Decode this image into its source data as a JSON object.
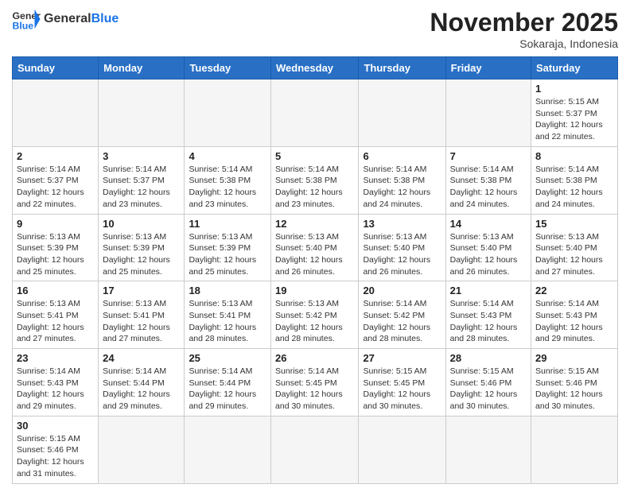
{
  "header": {
    "logo_general": "General",
    "logo_blue": "Blue",
    "month": "November 2025",
    "location": "Sokaraja, Indonesia"
  },
  "weekdays": [
    "Sunday",
    "Monday",
    "Tuesday",
    "Wednesday",
    "Thursday",
    "Friday",
    "Saturday"
  ],
  "weeks": [
    [
      {
        "day": "",
        "info": ""
      },
      {
        "day": "",
        "info": ""
      },
      {
        "day": "",
        "info": ""
      },
      {
        "day": "",
        "info": ""
      },
      {
        "day": "",
        "info": ""
      },
      {
        "day": "",
        "info": ""
      },
      {
        "day": "1",
        "info": "Sunrise: 5:15 AM\nSunset: 5:37 PM\nDaylight: 12 hours and 22 minutes."
      }
    ],
    [
      {
        "day": "2",
        "info": "Sunrise: 5:14 AM\nSunset: 5:37 PM\nDaylight: 12 hours and 22 minutes."
      },
      {
        "day": "3",
        "info": "Sunrise: 5:14 AM\nSunset: 5:37 PM\nDaylight: 12 hours and 23 minutes."
      },
      {
        "day": "4",
        "info": "Sunrise: 5:14 AM\nSunset: 5:38 PM\nDaylight: 12 hours and 23 minutes."
      },
      {
        "day": "5",
        "info": "Sunrise: 5:14 AM\nSunset: 5:38 PM\nDaylight: 12 hours and 23 minutes."
      },
      {
        "day": "6",
        "info": "Sunrise: 5:14 AM\nSunset: 5:38 PM\nDaylight: 12 hours and 24 minutes."
      },
      {
        "day": "7",
        "info": "Sunrise: 5:14 AM\nSunset: 5:38 PM\nDaylight: 12 hours and 24 minutes."
      },
      {
        "day": "8",
        "info": "Sunrise: 5:14 AM\nSunset: 5:38 PM\nDaylight: 12 hours and 24 minutes."
      }
    ],
    [
      {
        "day": "9",
        "info": "Sunrise: 5:13 AM\nSunset: 5:39 PM\nDaylight: 12 hours and 25 minutes."
      },
      {
        "day": "10",
        "info": "Sunrise: 5:13 AM\nSunset: 5:39 PM\nDaylight: 12 hours and 25 minutes."
      },
      {
        "day": "11",
        "info": "Sunrise: 5:13 AM\nSunset: 5:39 PM\nDaylight: 12 hours and 25 minutes."
      },
      {
        "day": "12",
        "info": "Sunrise: 5:13 AM\nSunset: 5:40 PM\nDaylight: 12 hours and 26 minutes."
      },
      {
        "day": "13",
        "info": "Sunrise: 5:13 AM\nSunset: 5:40 PM\nDaylight: 12 hours and 26 minutes."
      },
      {
        "day": "14",
        "info": "Sunrise: 5:13 AM\nSunset: 5:40 PM\nDaylight: 12 hours and 26 minutes."
      },
      {
        "day": "15",
        "info": "Sunrise: 5:13 AM\nSunset: 5:40 PM\nDaylight: 12 hours and 27 minutes."
      }
    ],
    [
      {
        "day": "16",
        "info": "Sunrise: 5:13 AM\nSunset: 5:41 PM\nDaylight: 12 hours and 27 minutes."
      },
      {
        "day": "17",
        "info": "Sunrise: 5:13 AM\nSunset: 5:41 PM\nDaylight: 12 hours and 27 minutes."
      },
      {
        "day": "18",
        "info": "Sunrise: 5:13 AM\nSunset: 5:41 PM\nDaylight: 12 hours and 28 minutes."
      },
      {
        "day": "19",
        "info": "Sunrise: 5:13 AM\nSunset: 5:42 PM\nDaylight: 12 hours and 28 minutes."
      },
      {
        "day": "20",
        "info": "Sunrise: 5:14 AM\nSunset: 5:42 PM\nDaylight: 12 hours and 28 minutes."
      },
      {
        "day": "21",
        "info": "Sunrise: 5:14 AM\nSunset: 5:43 PM\nDaylight: 12 hours and 28 minutes."
      },
      {
        "day": "22",
        "info": "Sunrise: 5:14 AM\nSunset: 5:43 PM\nDaylight: 12 hours and 29 minutes."
      }
    ],
    [
      {
        "day": "23",
        "info": "Sunrise: 5:14 AM\nSunset: 5:43 PM\nDaylight: 12 hours and 29 minutes."
      },
      {
        "day": "24",
        "info": "Sunrise: 5:14 AM\nSunset: 5:44 PM\nDaylight: 12 hours and 29 minutes."
      },
      {
        "day": "25",
        "info": "Sunrise: 5:14 AM\nSunset: 5:44 PM\nDaylight: 12 hours and 29 minutes."
      },
      {
        "day": "26",
        "info": "Sunrise: 5:14 AM\nSunset: 5:45 PM\nDaylight: 12 hours and 30 minutes."
      },
      {
        "day": "27",
        "info": "Sunrise: 5:15 AM\nSunset: 5:45 PM\nDaylight: 12 hours and 30 minutes."
      },
      {
        "day": "28",
        "info": "Sunrise: 5:15 AM\nSunset: 5:46 PM\nDaylight: 12 hours and 30 minutes."
      },
      {
        "day": "29",
        "info": "Sunrise: 5:15 AM\nSunset: 5:46 PM\nDaylight: 12 hours and 30 minutes."
      }
    ],
    [
      {
        "day": "30",
        "info": "Sunrise: 5:15 AM\nSunset: 5:46 PM\nDaylight: 12 hours and 31 minutes."
      },
      {
        "day": "",
        "info": ""
      },
      {
        "day": "",
        "info": ""
      },
      {
        "day": "",
        "info": ""
      },
      {
        "day": "",
        "info": ""
      },
      {
        "day": "",
        "info": ""
      },
      {
        "day": "",
        "info": ""
      }
    ]
  ]
}
